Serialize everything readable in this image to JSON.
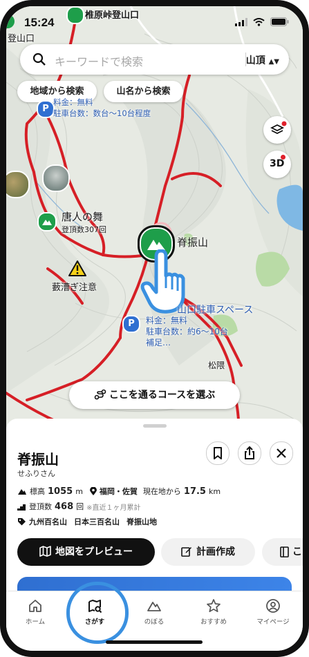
{
  "status": {
    "time": "15:24"
  },
  "search": {
    "placeholder": "キーワードで検索",
    "scope": "山頂"
  },
  "chips": {
    "by_region": "地域から検索",
    "by_name": "山名から検索"
  },
  "map": {
    "labels": {
      "top_poi": "椎原峠登山口",
      "top_left": "登山口",
      "karabito": "唐人の舞",
      "karabito_count": "登頂数307回",
      "warning": "藪漕ぎ注意",
      "selected_peak": "脊振山",
      "parking_top_fee": "料金：無料",
      "parking_top_spaces": "駐車台数：数台〜10台程度",
      "parking_name": "山口駐車スペース",
      "parking_fee": "料金：無料",
      "parking_spaces": "駐車台数：約6〜10台",
      "parking_more": "補足…",
      "place_matsukuma": "松隈"
    },
    "layers_icon": "layers-icon",
    "threed_label": "3D",
    "route_button": "ここを通るコースを選ぶ"
  },
  "sheet": {
    "name": "脊振山",
    "reading": "せふりさん",
    "elev_label": "標高",
    "elev_value": "1055",
    "elev_unit": "m",
    "region": "福岡・佐賀",
    "dist_label": "現在地から",
    "dist_value": "17.5",
    "dist_unit": "km",
    "climbs_label": "登頂数",
    "climbs_value": "468",
    "climbs_unit": "回",
    "climbs_note": "※直近１ヶ月累計",
    "tags": [
      "九州百名山",
      "日本三百名山",
      "脊振山地"
    ],
    "btn_preview": "地図をプレビュー",
    "btn_plan": "計画作成",
    "btn_more": "こ"
  },
  "tabs": [
    {
      "label": "ホーム",
      "icon": "home-icon"
    },
    {
      "label": "さがす",
      "icon": "map-search-icon"
    },
    {
      "label": "のぼる",
      "icon": "mountain-icon"
    },
    {
      "label": "おすすめ",
      "icon": "star-icon"
    },
    {
      "label": "マイページ",
      "icon": "user-icon"
    }
  ],
  "colors": {
    "accent": "#1e9e4a",
    "route": "#d61f26",
    "highlight": "#3a90e0",
    "dark": "#111111"
  }
}
